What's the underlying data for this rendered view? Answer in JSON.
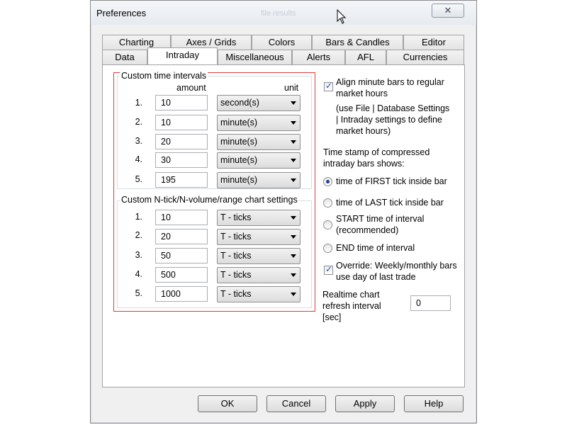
{
  "window": {
    "title": "Preferences",
    "faded_title": "file results",
    "close_symbol": "✕"
  },
  "tabs": {
    "row_back": [
      "Charting",
      "Axes / Grids",
      "Colors",
      "Bars & Candles",
      "Editor"
    ],
    "row_front": [
      "Data",
      "Intraday",
      "Miscellaneous",
      "Alerts",
      "AFL",
      "Currencies"
    ],
    "active": "Intraday"
  },
  "custom_intervals": {
    "label": "Custom time intervals",
    "col_amount": "amount",
    "col_unit": "unit",
    "rows": [
      {
        "num": "1.",
        "amount": "10",
        "unit": "second(s)"
      },
      {
        "num": "2.",
        "amount": "10",
        "unit": "minute(s)"
      },
      {
        "num": "3.",
        "amount": "20",
        "unit": "minute(s)"
      },
      {
        "num": "4.",
        "amount": "30",
        "unit": "minute(s)"
      },
      {
        "num": "5.",
        "amount": "195",
        "unit": "minute(s)"
      }
    ]
  },
  "custom_ntick": {
    "label": "Custom N-tick/N-volume/range chart settings",
    "rows": [
      {
        "num": "1.",
        "amount": "10",
        "unit": "T - ticks"
      },
      {
        "num": "2.",
        "amount": "20",
        "unit": "T - ticks"
      },
      {
        "num": "3.",
        "amount": "50",
        "unit": "T - ticks"
      },
      {
        "num": "4.",
        "amount": "500",
        "unit": "T - ticks"
      },
      {
        "num": "5.",
        "amount": "1000",
        "unit": "T - ticks"
      }
    ]
  },
  "right": {
    "align_label_1": "Align minute bars to regular",
    "align_label_2": "market hours",
    "align_checked": true,
    "note_1": "(use File | Database Settings",
    "note_2": "| Intraday settings to define",
    "note_3": "market hours)",
    "timestamp_label_1": "Time stamp of compressed",
    "timestamp_label_2": "intraday bars shows:",
    "radio_first": "time of FIRST tick inside bar",
    "radio_last": "time of LAST tick inside bar",
    "radio_start_1": "START time of interval",
    "radio_start_2": "(recommended)",
    "radio_end": "END time of interval",
    "selected_radio": "time of FIRST tick inside bar",
    "override_1": "Override: Weekly/monthly bars",
    "override_2": "use day of last trade",
    "override_checked": true,
    "refresh_label_1": "Realtime chart",
    "refresh_label_2": "refresh interval",
    "refresh_label_3": "[sec]",
    "refresh_value": "0"
  },
  "buttons": {
    "ok": "OK",
    "cancel": "Cancel",
    "apply": "Apply",
    "help": "Help"
  },
  "colors": {
    "highlight_border": "#e23c3c",
    "dialog_bg": "#f0f0f0",
    "panel_bg": "#ffffff"
  }
}
